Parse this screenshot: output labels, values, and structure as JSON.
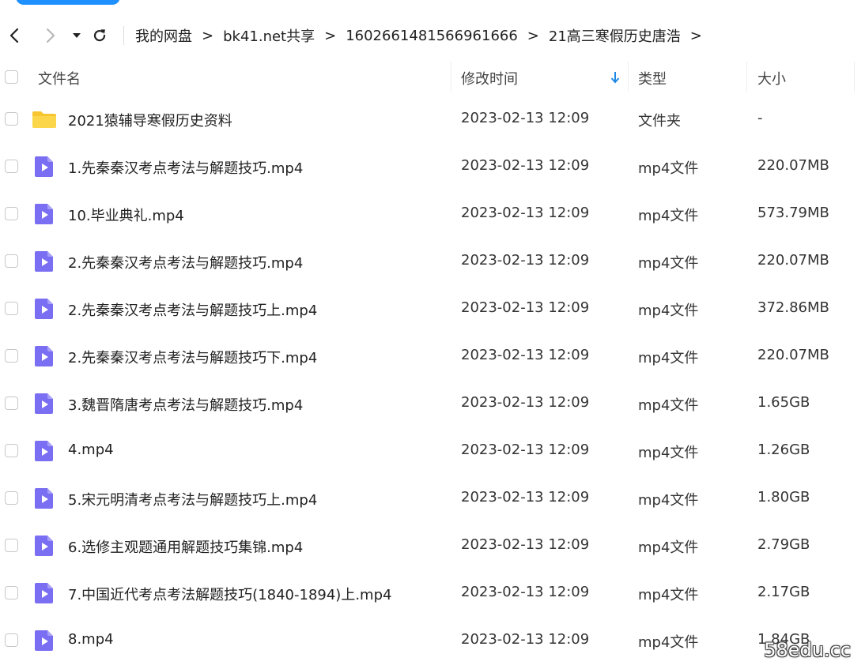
{
  "nav": {
    "breadcrumb": [
      "我的网盘",
      "bk41.net共享",
      "1602661481566961666",
      "21高三寒假历史唐浩"
    ],
    "separator": ">"
  },
  "columns": {
    "name": "文件名",
    "modified": "修改时间",
    "type": "类型",
    "size": "大小"
  },
  "files": [
    {
      "name": "2021猿辅导寒假历史资料",
      "modified": "2023-02-13 12:09",
      "type": "文件夹",
      "size": "-",
      "icon": "folder-icon"
    },
    {
      "name": "1.先秦秦汉考点考法与解题技巧.mp4",
      "modified": "2023-02-13 12:09",
      "type": "mp4文件",
      "size": "220.07MB",
      "icon": "video-file-icon"
    },
    {
      "name": "10.毕业典礼.mp4",
      "modified": "2023-02-13 12:09",
      "type": "mp4文件",
      "size": "573.79MB",
      "icon": "video-file-icon"
    },
    {
      "name": "2.先秦秦汉考点考法与解题技巧.mp4",
      "modified": "2023-02-13 12:09",
      "type": "mp4文件",
      "size": "220.07MB",
      "icon": "video-file-icon"
    },
    {
      "name": "2.先秦秦汉考点考法与解题技巧上.mp4",
      "modified": "2023-02-13 12:09",
      "type": "mp4文件",
      "size": "372.86MB",
      "icon": "video-file-icon"
    },
    {
      "name": "2.先秦秦汉考点考法与解题技巧下.mp4",
      "modified": "2023-02-13 12:09",
      "type": "mp4文件",
      "size": "220.07MB",
      "icon": "video-file-icon"
    },
    {
      "name": "3.魏晋隋唐考点考法与解题技巧.mp4",
      "modified": "2023-02-13 12:09",
      "type": "mp4文件",
      "size": "1.65GB",
      "icon": "video-file-icon"
    },
    {
      "name": "4.mp4",
      "modified": "2023-02-13 12:09",
      "type": "mp4文件",
      "size": "1.26GB",
      "icon": "video-file-icon"
    },
    {
      "name": "5.宋元明清考点考法与解题技巧上.mp4",
      "modified": "2023-02-13 12:09",
      "type": "mp4文件",
      "size": "1.80GB",
      "icon": "video-file-icon"
    },
    {
      "name": "6.选修主观题通用解题技巧集锦.mp4",
      "modified": "2023-02-13 12:09",
      "type": "mp4文件",
      "size": "2.79GB",
      "icon": "video-file-icon"
    },
    {
      "name": "7.中国近代考点考法解题技巧(1840-1894)上.mp4",
      "modified": "2023-02-13 12:09",
      "type": "mp4文件",
      "size": "2.17GB",
      "icon": "video-file-icon"
    },
    {
      "name": "8.mp4",
      "modified": "2023-02-13 12:09",
      "type": "mp4文件",
      "size": "1.84GB",
      "icon": "video-file-icon"
    }
  ],
  "watermark": "58edu.cc",
  "colors": {
    "accent": "#1e90ff",
    "folder": "#f7c532",
    "video_icon": "#7a6ef2",
    "sort_arrow": "#1e88e5"
  }
}
